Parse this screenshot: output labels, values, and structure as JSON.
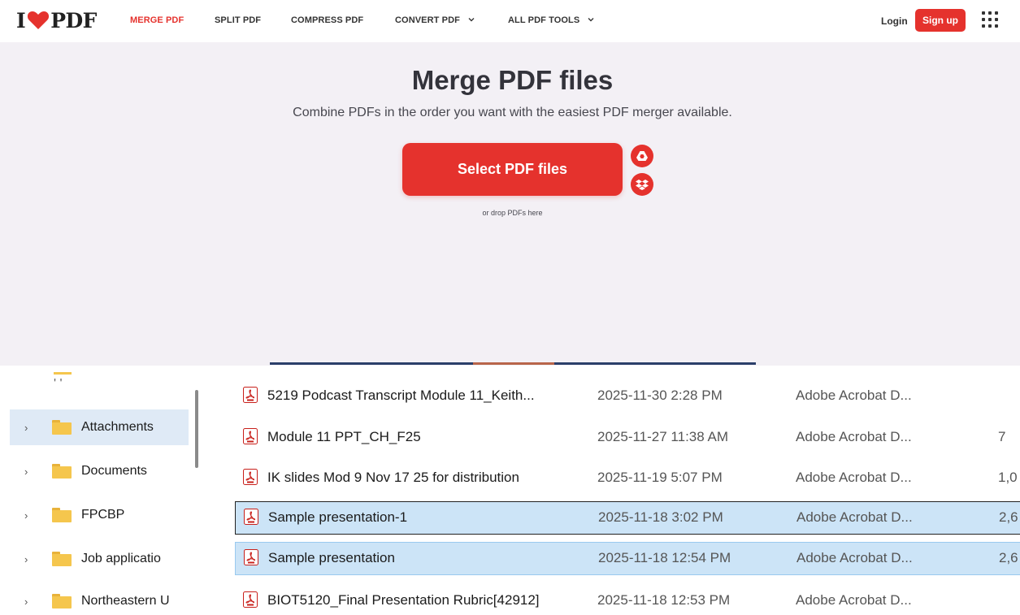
{
  "web": {
    "logo": {
      "left": "I",
      "right": "PDF"
    },
    "nav": [
      {
        "label": "MERGE PDF",
        "active": true,
        "dropdown": false
      },
      {
        "label": "SPLIT PDF",
        "active": false,
        "dropdown": false
      },
      {
        "label": "COMPRESS PDF",
        "active": false,
        "dropdown": false
      },
      {
        "label": "CONVERT PDF",
        "active": false,
        "dropdown": true
      },
      {
        "label": "ALL PDF TOOLS",
        "active": false,
        "dropdown": true
      }
    ],
    "login": "Login",
    "signup": "Sign up",
    "title": "Merge PDF files",
    "subtitle": "Combine PDFs in the order you want with the easiest PDF merger available.",
    "select_button": "Select PDF files",
    "drop_hint": "or drop PDFs here",
    "colors": {
      "brand_red": "#e5322d",
      "bg": "#f3f0f5"
    }
  },
  "explorer": {
    "nav_partial_label": "' '",
    "nav_items": [
      {
        "label": "Attachments",
        "selected": true
      },
      {
        "label": "Documents",
        "selected": false
      },
      {
        "label": "FPCBP",
        "selected": false
      },
      {
        "label": "Job applicatio",
        "selected": false
      },
      {
        "label": "Northeastern U",
        "selected": false
      }
    ],
    "files": [
      {
        "name": "5219 Podcast Transcript Module 11_Keith...",
        "date": "2025-11-30 2:28 PM",
        "type": "Adobe Acrobat D...",
        "size": ""
      },
      {
        "name": "Module 11 PPT_CH_F25",
        "date": "2025-11-27 11:38 AM",
        "type": "Adobe Acrobat D...",
        "size": "7"
      },
      {
        "name": "IK slides Mod 9 Nov 17 25 for distribution",
        "date": "2025-11-19 5:07 PM",
        "type": "Adobe Acrobat D...",
        "size": "1,0"
      },
      {
        "name": "Sample presentation-1",
        "date": "2025-11-18 3:02 PM",
        "type": "Adobe Acrobat D...",
        "size": "2,6"
      },
      {
        "name": "Sample presentation",
        "date": "2025-11-18 12:54 PM",
        "type": "Adobe Acrobat D...",
        "size": "2,6"
      },
      {
        "name": "BIOT5120_Final Presentation Rubric[42912]",
        "date": "2025-11-18 12:53 PM",
        "type": "Adobe Acrobat D...",
        "size": ""
      }
    ]
  }
}
